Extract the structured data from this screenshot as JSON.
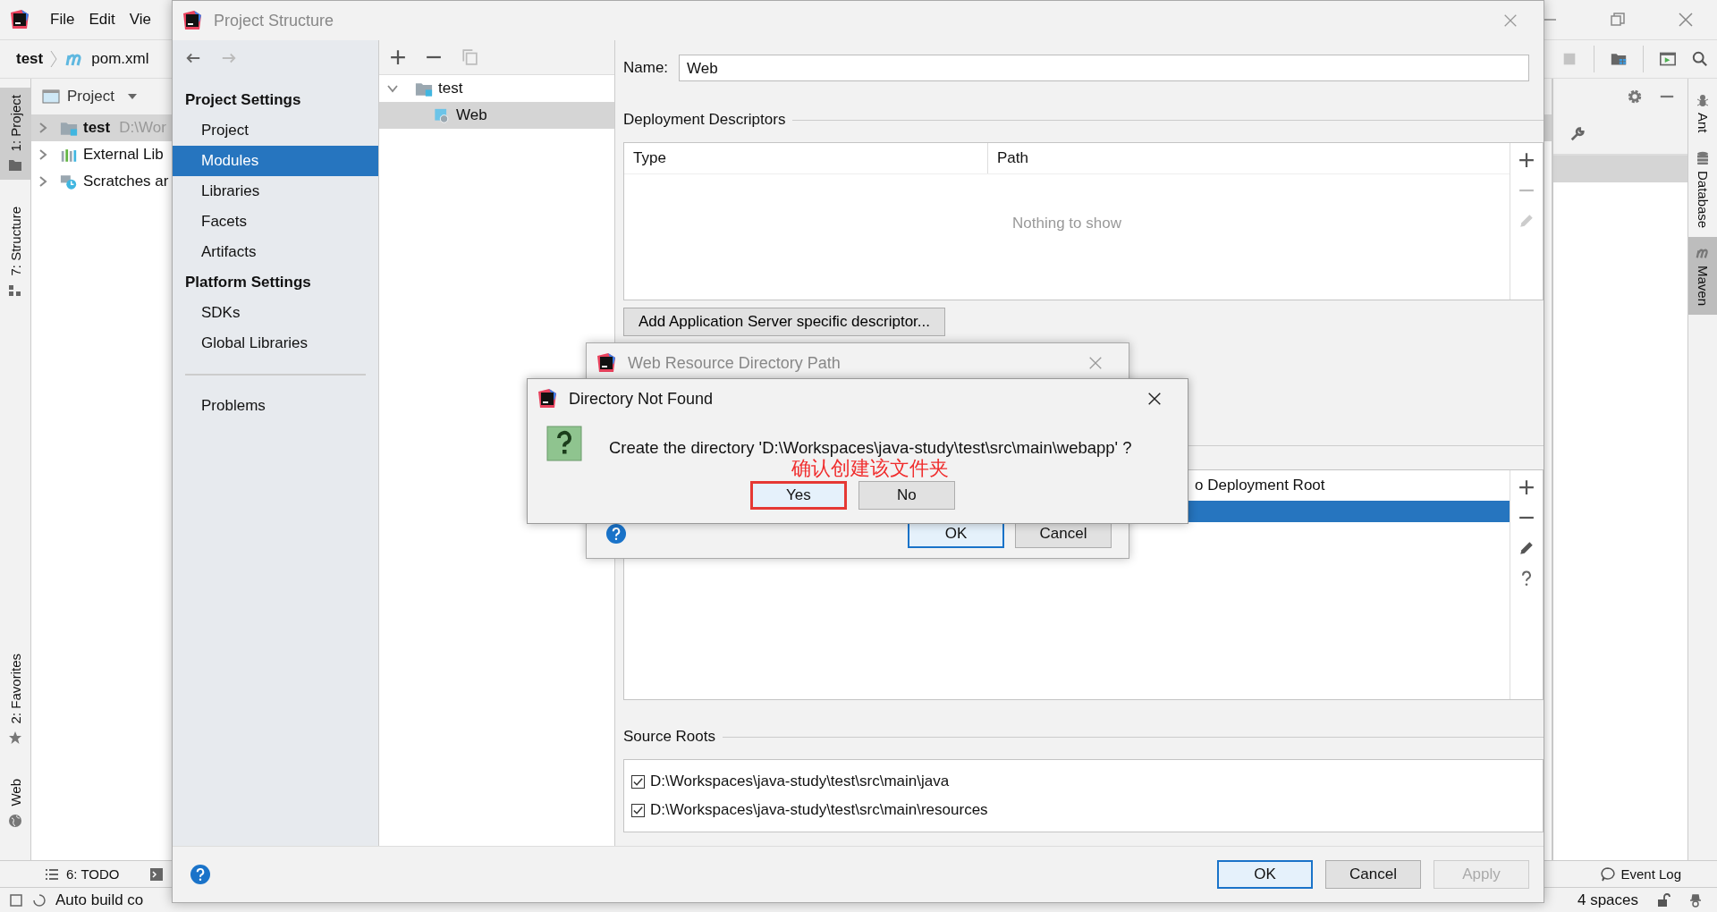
{
  "ide": {
    "menu": [
      {
        "label": "File"
      },
      {
        "label": "Edit"
      },
      {
        "label": "Vie"
      }
    ],
    "breadcrumb": [
      {
        "label": "test",
        "kind": "project"
      },
      {
        "label": "pom.xml",
        "kind": "maven"
      }
    ],
    "left_tool_tabs": [
      {
        "label": "1: Project",
        "selected": true,
        "kind": "folder"
      },
      {
        "label": "7: Structure",
        "selected": false,
        "kind": "structure"
      }
    ],
    "left_tool_tabs_bottom": [
      {
        "label": "2: Favorites",
        "selected": false,
        "kind": "star"
      },
      {
        "label": "Web",
        "selected": false,
        "kind": "globe"
      }
    ],
    "project_panel": {
      "title": "Project",
      "tree": [
        {
          "name": "test",
          "detail": "D:\\Wor",
          "kind": "module",
          "selected": true
        },
        {
          "name": "External Lib",
          "kind": "libraries",
          "selected": false
        },
        {
          "name": "Scratches ar",
          "kind": "scratches",
          "selected": false
        }
      ]
    },
    "right_tool_tabs": [
      {
        "label": "Ant",
        "selected": false,
        "kind": "ant"
      },
      {
        "label": "Database",
        "selected": false,
        "kind": "database"
      },
      {
        "label": "Maven",
        "selected": true,
        "kind": "maven"
      }
    ],
    "bottom_tool_tabs": [
      {
        "label": "6: TODO"
      }
    ],
    "event_log": "Event Log",
    "status_bar": {
      "message": "Auto build co",
      "indent": "4 spaces"
    }
  },
  "project_structure": {
    "title": "Project Structure",
    "nav": [
      {
        "label": "Project Settings",
        "kind": "header"
      },
      {
        "label": "Project",
        "kind": "item",
        "selected": false
      },
      {
        "label": "Modules",
        "kind": "item",
        "selected": true
      },
      {
        "label": "Libraries",
        "kind": "item",
        "selected": false
      },
      {
        "label": "Facets",
        "kind": "item",
        "selected": false
      },
      {
        "label": "Artifacts",
        "kind": "item",
        "selected": false
      },
      {
        "label": "Platform Settings",
        "kind": "header"
      },
      {
        "label": "SDKs",
        "kind": "item",
        "selected": false
      },
      {
        "label": "Global Libraries",
        "kind": "item",
        "selected": false
      },
      {
        "kind": "separator"
      },
      {
        "label": "Problems",
        "kind": "item",
        "selected": false
      }
    ],
    "modules_tree": [
      {
        "name": "test",
        "expanded": true,
        "selected": false,
        "children": [
          {
            "name": "Web",
            "selected": true
          }
        ]
      }
    ],
    "name_label": "Name:",
    "name_value": "Web",
    "deployment_descriptors": {
      "title": "Deployment Descriptors",
      "columns": [
        "Type",
        "Path"
      ],
      "empty_text": "Nothing to show",
      "add_button": "Add Application Server specific descriptor..."
    },
    "web_resource_directories": {
      "columns": [
        "o Deployment Root"
      ],
      "rows": [
        {
          "selected": true
        }
      ]
    },
    "source_roots": {
      "title": "Source Roots",
      "items": [
        {
          "path": "D:\\Workspaces\\java-study\\test\\src\\main\\java",
          "checked": true
        },
        {
          "path": "D:\\Workspaces\\java-study\\test\\src\\main\\resources",
          "checked": true
        }
      ]
    },
    "buttons": [
      {
        "label": "OK",
        "default": true,
        "disabled": false
      },
      {
        "label": "Cancel",
        "default": false,
        "disabled": false
      },
      {
        "label": "Apply",
        "default": false,
        "disabled": true
      }
    ]
  },
  "web_resource_dialog": {
    "title": "Web Resource Directory Path",
    "buttons": [
      {
        "label": "OK",
        "default": true
      },
      {
        "label": "Cancel",
        "default": false
      }
    ]
  },
  "confirm_dialog": {
    "title": "Directory Not Found",
    "message": "Create the directory 'D:\\Workspaces\\java-study\\test\\src\\main\\webapp' ?",
    "annotation": "确认创建该文件夹",
    "buttons": [
      {
        "label": "Yes",
        "default": true,
        "highlighted": true
      },
      {
        "label": "No",
        "default": false,
        "highlighted": false
      }
    ]
  }
}
